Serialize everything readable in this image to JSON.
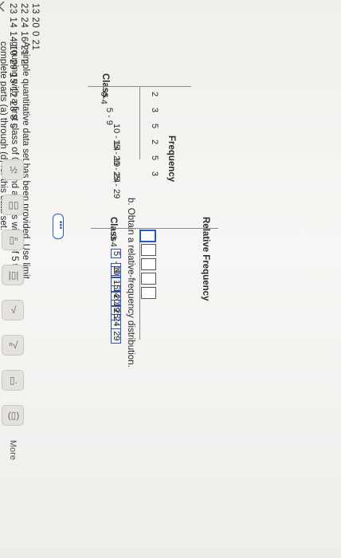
{
  "dataset": {
    "row1": "13  20  0  21",
    "row2": "22  24  16  21  2",
    "row3": "23  14  14  10  29  15  12  28  8  5"
  },
  "instructions": {
    "line1": "A simple quantitative data set has been provided. Use limit",
    "line2": "grouping with a first class of 0-4 and a class width of 5 to",
    "line3": "complete parts (a) through (d) for this data set."
  },
  "freq_table": {
    "headers": [
      "Class",
      "Frequency"
    ],
    "rows": [
      {
        "class": "0-4",
        "freq": "2"
      },
      {
        "class": "5 - 9",
        "freq": "3"
      },
      {
        "class": "10 - 14",
        "freq": "5"
      },
      {
        "class": "15 - 19",
        "freq": "2"
      },
      {
        "class": "20 - 24",
        "freq": "5"
      },
      {
        "class": "25 - 29",
        "freq": "3"
      }
    ]
  },
  "part_b": {
    "prompt": "b. Obtain a relative-frequency distribution."
  },
  "rel_table": {
    "headers": [
      "Class",
      "Relative Frequency"
    ],
    "dash": "-",
    "rows": [
      {
        "class": "0-4"
      },
      {
        "lower": "5",
        "upper": "9"
      },
      {
        "lower": "10",
        "upper": "14"
      },
      {
        "lower": "15",
        "upper": "19"
      },
      {
        "lower": "20",
        "upper": "24"
      },
      {
        "lower": "25",
        "upper": "29"
      }
    ]
  },
  "toolbar": {
    "more": "More"
  }
}
